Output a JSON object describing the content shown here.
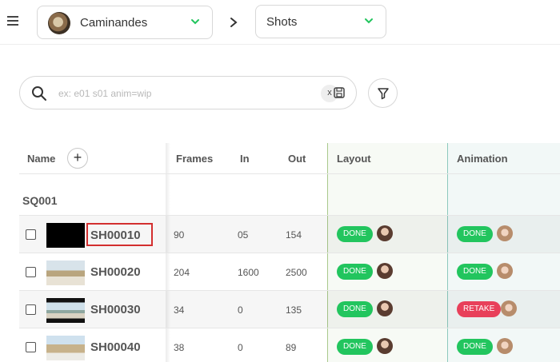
{
  "header": {
    "production": {
      "name": "Caminandes",
      "avatar_icon": "production-avatar"
    },
    "section": {
      "name": "Shots"
    }
  },
  "search": {
    "placeholder": "ex: e01 s01 anim=wip",
    "clear_label": "x"
  },
  "table": {
    "columns": {
      "name": "Name",
      "frames": "Frames",
      "in": "In",
      "out": "Out",
      "layout": "Layout",
      "animation": "Animation"
    },
    "add_label": "+",
    "sequence": "SQ001",
    "rows": [
      {
        "name": "SH00010",
        "frames": "90",
        "in": "05",
        "out": "154",
        "layout": "DONE",
        "animation": "DONE"
      },
      {
        "name": "SH00020",
        "frames": "204",
        "in": "1600",
        "out": "2500",
        "layout": "DONE",
        "animation": "DONE"
      },
      {
        "name": "SH00030",
        "frames": "34",
        "in": "0",
        "out": "135",
        "layout": "DONE",
        "animation": "RETAKE"
      },
      {
        "name": "SH00040",
        "frames": "38",
        "in": "0",
        "out": "89",
        "layout": "DONE",
        "animation": "DONE"
      }
    ]
  },
  "colors": {
    "done": "#22c55e",
    "retake": "#e8405a",
    "layout_accent": "#a9c98c",
    "animation_accent": "#8cc9bd",
    "selection": "#d32f2f"
  }
}
